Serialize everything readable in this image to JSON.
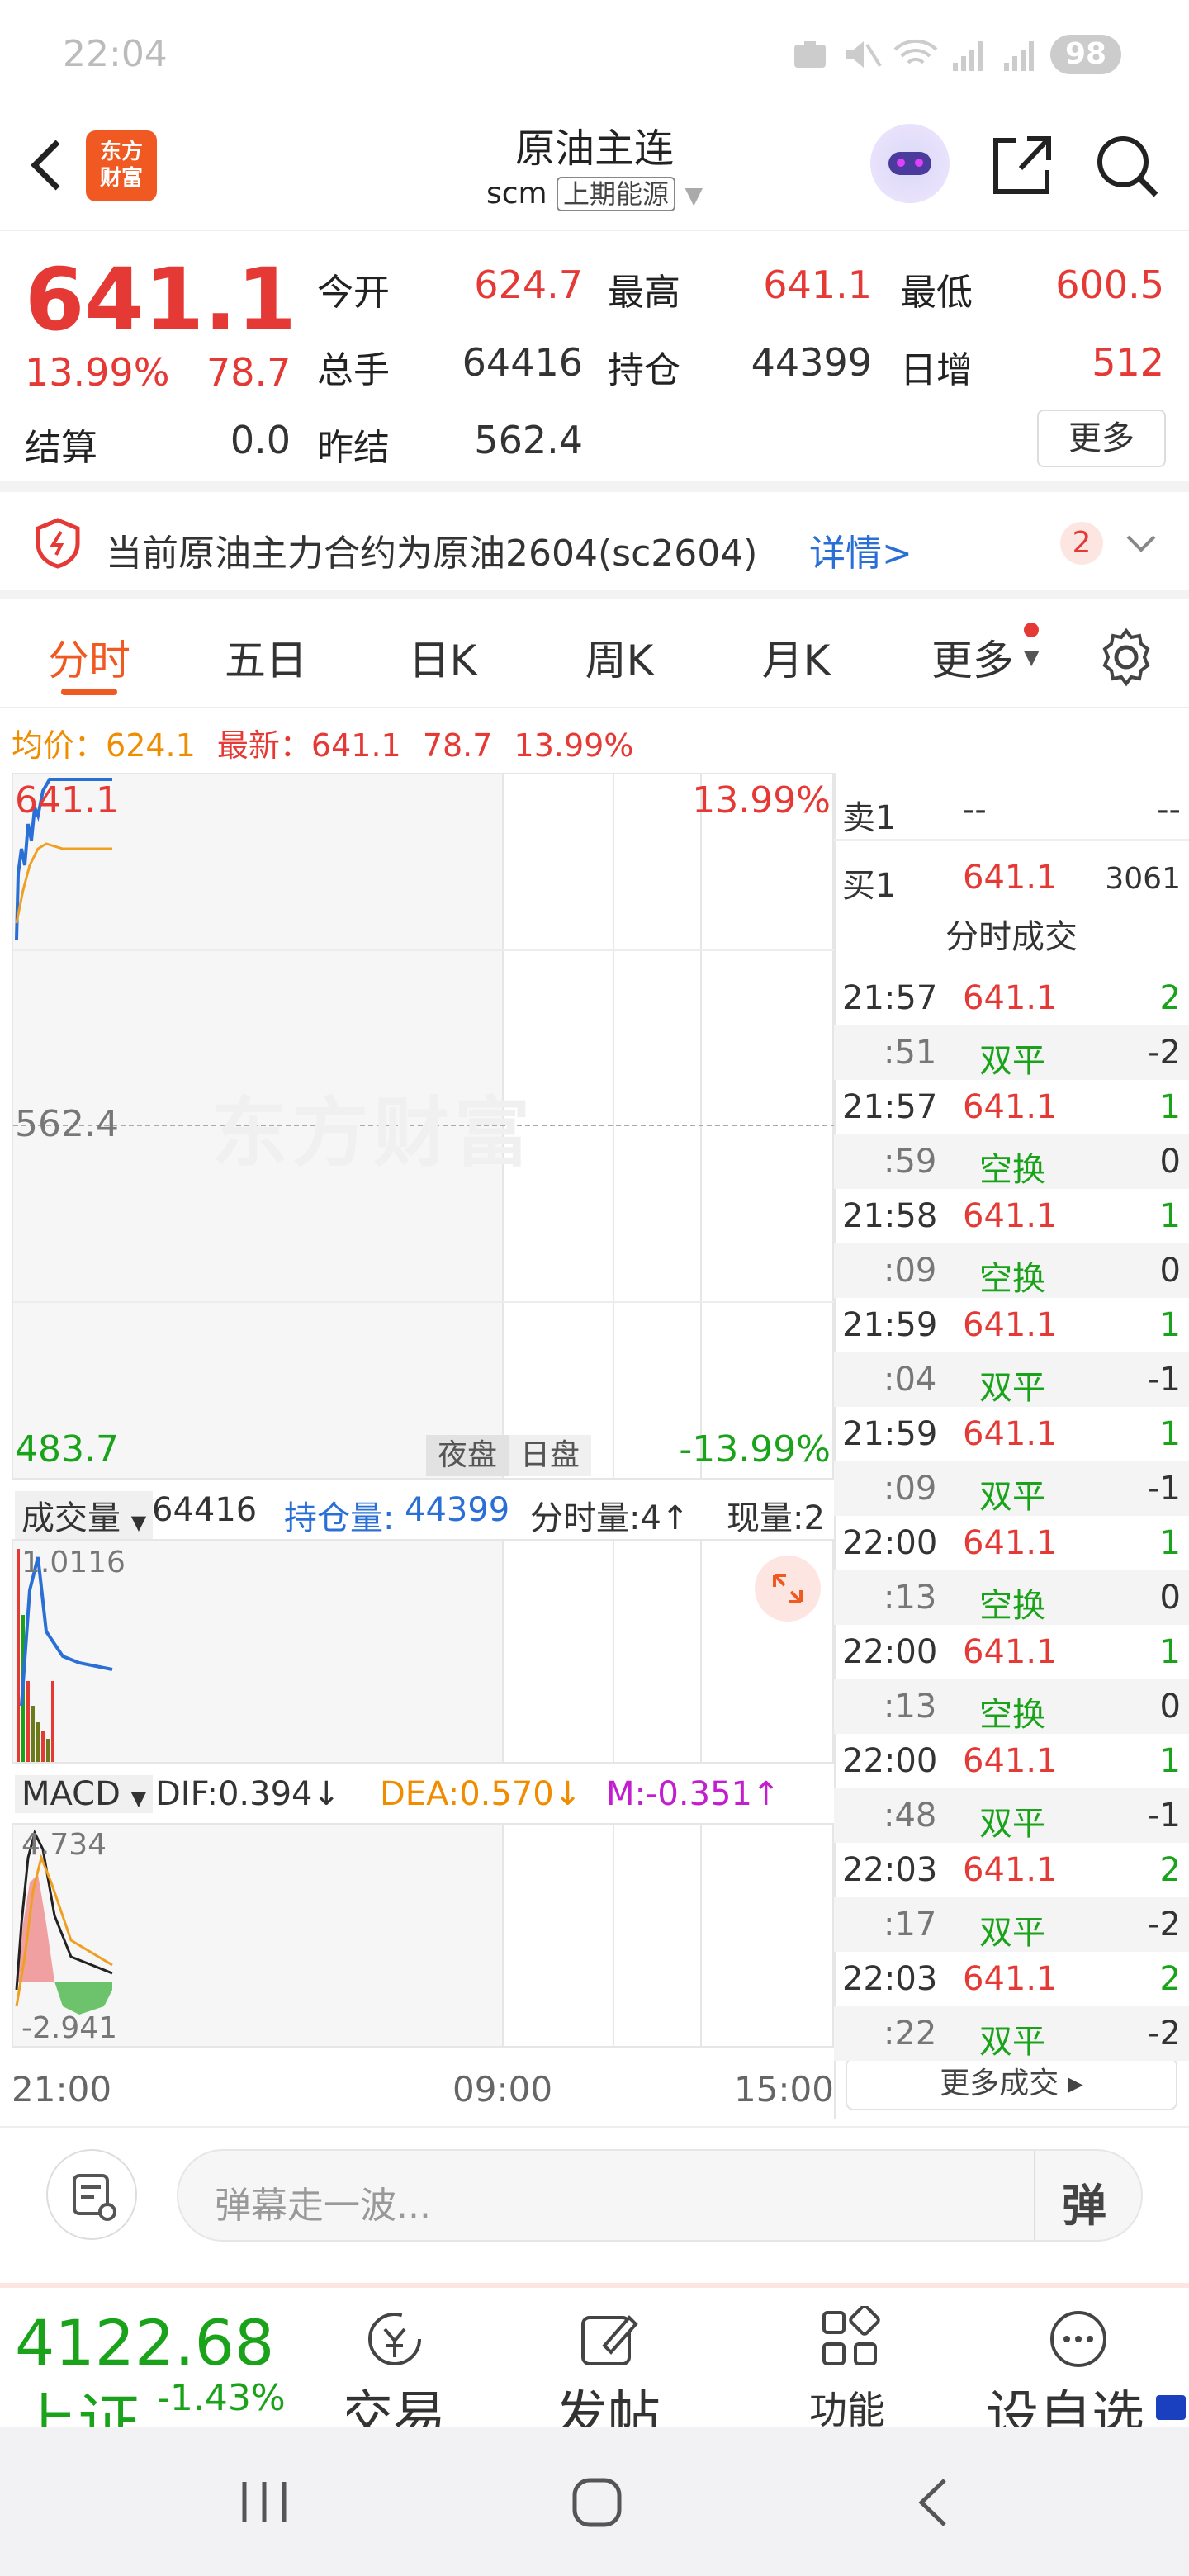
{
  "status_bar": {
    "time": "22:04",
    "battery": "98",
    "signal_1": "5G",
    "signal_2": "5G",
    "wifi": "6"
  },
  "header": {
    "title": "原油主连",
    "code": "scm",
    "exchange": "上期能源",
    "logo_line1": "东方",
    "logo_line2": "财富"
  },
  "quote": {
    "price": "641.1",
    "change_pct": "13.99%",
    "change": "78.7",
    "stats": [
      {
        "label": "今开",
        "value": "624.7",
        "color": "red"
      },
      {
        "label": "最高",
        "value": "641.1",
        "color": "red"
      },
      {
        "label": "最低",
        "value": "600.5",
        "color": "red"
      },
      {
        "label": "总手",
        "value": "64416",
        "color": "dark"
      },
      {
        "label": "持仓",
        "value": "44399",
        "color": "dark"
      },
      {
        "label": "日增",
        "value": "512",
        "color": "red"
      },
      {
        "label": "结算",
        "value": "0.0",
        "color": "dark"
      },
      {
        "label": "昨结",
        "value": "562.4",
        "color": "dark"
      }
    ],
    "more_button": "更多"
  },
  "banner": {
    "text": "当前原油主力合约为原油2604(sc2604)",
    "link": "详情>",
    "badge": "2"
  },
  "tabs": [
    {
      "label": "分时",
      "active": true
    },
    {
      "label": "五日",
      "active": false
    },
    {
      "label": "日K",
      "active": false
    },
    {
      "label": "周K",
      "active": false
    },
    {
      "label": "月K",
      "active": false
    },
    {
      "label": "更多",
      "active": false
    }
  ],
  "info_line": {
    "avg_label": "均价：",
    "avg_value": "624.1",
    "latest_label": "最新：",
    "latest_value": "641.1",
    "change": "78.7",
    "change_pct": "13.99%"
  },
  "price_chart": {
    "top_price": "641.1",
    "top_pct": "13.99%",
    "mid_price": "562.4",
    "bottom_price": "483.7",
    "bottom_pct": "-13.99%",
    "session_night": "夜盘",
    "session_day": "日盘",
    "watermark": "东方财富"
  },
  "volume_bar": {
    "selector": "成交量",
    "volume": "64416",
    "oi_label": "持仓量:",
    "oi_value": "44399",
    "tick_label": "分时量:4↑",
    "now_label": "现量:2"
  },
  "volume_chart": {
    "max_label": "1.0116"
  },
  "macd_bar": {
    "selector": "MACD",
    "dif": "DIF:0.394↓",
    "dea": "DEA:0.570↓",
    "m": "M:-0.351↑"
  },
  "macd_chart": {
    "top_label": "4.734",
    "bottom_label": "-2.941"
  },
  "time_axis": [
    "21:00",
    "09:00",
    "15:00"
  ],
  "order_book": {
    "sell1_label": "卖1",
    "sell1_price": "--",
    "sell1_vol": "--",
    "buy1_label": "买1",
    "buy1_price": "641.1",
    "buy1_vol": "3061",
    "trades_title": "分时成交",
    "trades": [
      {
        "time": "21:57",
        "price": "641.1",
        "vol": "2",
        "sec": ":51",
        "type": "双平",
        "chg": "-2"
      },
      {
        "time": "21:57",
        "price": "641.1",
        "vol": "1",
        "sec": ":59",
        "type": "空换",
        "chg": "0"
      },
      {
        "time": "21:58",
        "price": "641.1",
        "vol": "1",
        "sec": ":09",
        "type": "空换",
        "chg": "0"
      },
      {
        "time": "21:59",
        "price": "641.1",
        "vol": "1",
        "sec": ":04",
        "type": "双平",
        "chg": "-1"
      },
      {
        "time": "21:59",
        "price": "641.1",
        "vol": "1",
        "sec": ":09",
        "type": "双平",
        "chg": "-1"
      },
      {
        "time": "22:00",
        "price": "641.1",
        "vol": "1",
        "sec": ":13",
        "type": "空换",
        "chg": "0"
      },
      {
        "time": "22:00",
        "price": "641.1",
        "vol": "1",
        "sec": ":13",
        "type": "空换",
        "chg": "0"
      },
      {
        "time": "22:00",
        "price": "641.1",
        "vol": "1",
        "sec": ":48",
        "type": "双平",
        "chg": "-1"
      },
      {
        "time": "22:03",
        "price": "641.1",
        "vol": "2",
        "sec": ":17",
        "type": "双平",
        "chg": "-2"
      },
      {
        "time": "22:03",
        "price": "641.1",
        "vol": "2",
        "sec": ":22",
        "type": "双平",
        "chg": "-2"
      }
    ],
    "more_trades": "更多成交"
  },
  "comment_input": {
    "placeholder": "弹幕走一波...",
    "barrage_label": "弹"
  },
  "bottom_nav": {
    "index_value": "4122.68",
    "index_name": "上证",
    "index_change": "-1.43%",
    "items": [
      "交易",
      "发帖",
      "功能",
      "设自选"
    ]
  },
  "colors": {
    "up": "#e53935",
    "down": "#1aa31a",
    "accent": "#f05a22",
    "link": "#2a6fd6"
  }
}
